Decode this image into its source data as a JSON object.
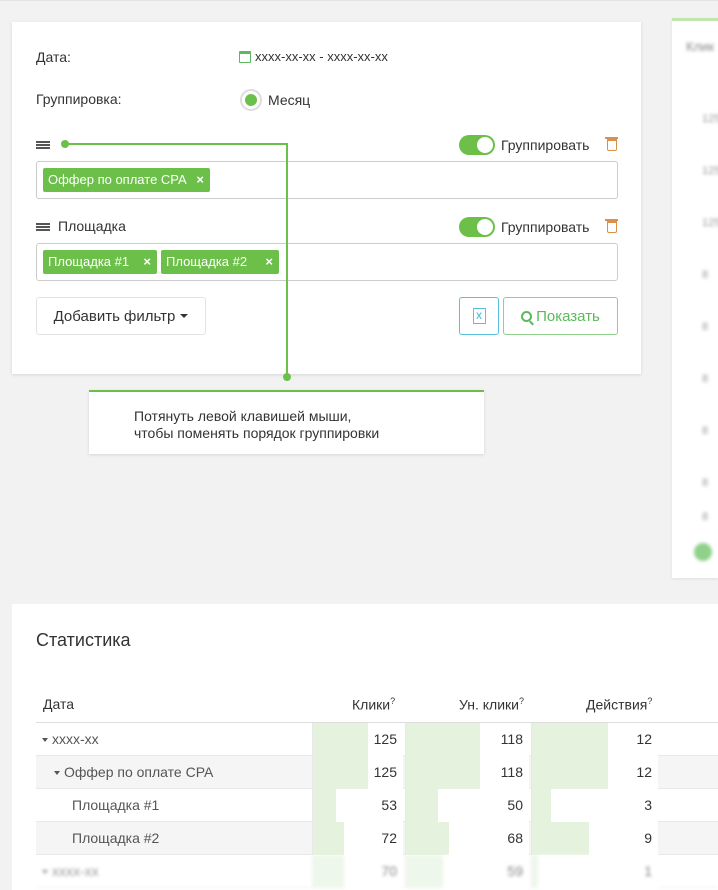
{
  "filters": {
    "date_label": "Дата:",
    "date_value": "xxxx-xx-xx - xxxx-xx-xx",
    "grouping_label": "Группировка:",
    "grouping_option": "Месяц",
    "group1": {
      "name": "",
      "toggle_label": "Группировать",
      "tags": [
        {
          "label": "Оффер по оплате CPA",
          "remove": "×"
        }
      ]
    },
    "group2": {
      "name": "Площадка",
      "toggle_label": "Группировать",
      "tags": [
        {
          "label": "Площадка #1",
          "remove": "×"
        },
        {
          "label": "Площадка #2",
          "remove": "×"
        }
      ]
    },
    "add_filter_label": "Добавить фильтр",
    "show_label": "Показать",
    "export_icon_text": "X"
  },
  "callout": {
    "line1": "Потянуть левой клавишей мыши,",
    "line2": "чтобы поменять порядок группировки"
  },
  "side_panel": {
    "title": "Клик",
    "numbers": [
      "125",
      "125",
      "125",
      "8",
      "8",
      "8",
      "8",
      "8",
      "8"
    ]
  },
  "stats": {
    "title": "Статистика",
    "columns": [
      "Дата",
      "Клики",
      "Ун. клики",
      "Действия"
    ],
    "col_hint": "?",
    "rows": [
      {
        "name": "xxxx-xx",
        "indent": 0,
        "expand": true,
        "clicks": 125,
        "uniq": 118,
        "actions": 12
      },
      {
        "name": "Оффер по оплате CPA",
        "indent": 1,
        "expand": true,
        "clicks": 125,
        "uniq": 118,
        "actions": 12
      },
      {
        "name": "Площадка #1",
        "indent": 2,
        "expand": false,
        "clicks": 53,
        "uniq": 50,
        "actions": 3
      },
      {
        "name": "Площадка #2",
        "indent": 2,
        "expand": false,
        "clicks": 72,
        "uniq": 68,
        "actions": 9
      },
      {
        "name": "xxxx-xx",
        "indent": 0,
        "expand": true,
        "clicks": 70,
        "uniq": 59,
        "actions": 1
      }
    ]
  },
  "colors": {
    "accent": "#6cc04a",
    "bar": "#e4f2de",
    "info": "#5bc0de",
    "trash": "#d9904a"
  }
}
